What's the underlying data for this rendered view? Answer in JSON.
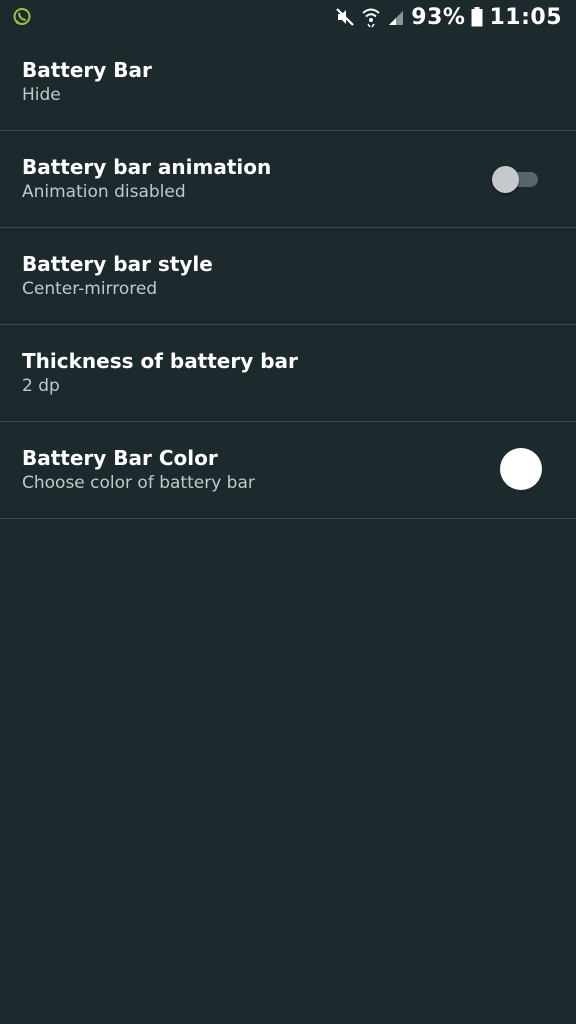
{
  "status_bar": {
    "battery_percent": "93%",
    "time": "11:05",
    "notification_icon": "whatsapp-icon",
    "icons": [
      "mute-icon",
      "wifi-icon",
      "signal-icon",
      "battery-icon"
    ]
  },
  "settings": [
    {
      "title": "Battery Bar",
      "summary": "Hide"
    },
    {
      "title": "Battery bar animation",
      "summary": "Animation disabled",
      "toggle": false
    },
    {
      "title": "Battery bar style",
      "summary": "Center-mirrored"
    },
    {
      "title": "Thickness of battery bar",
      "summary": "2 dp"
    },
    {
      "title": "Battery Bar Color",
      "summary": "Choose color of battery bar",
      "color": "#ffffff"
    }
  ],
  "colors": {
    "background": "#1c292d",
    "divider": "#3a474b",
    "whatsapp_green": "#9bc34a"
  }
}
